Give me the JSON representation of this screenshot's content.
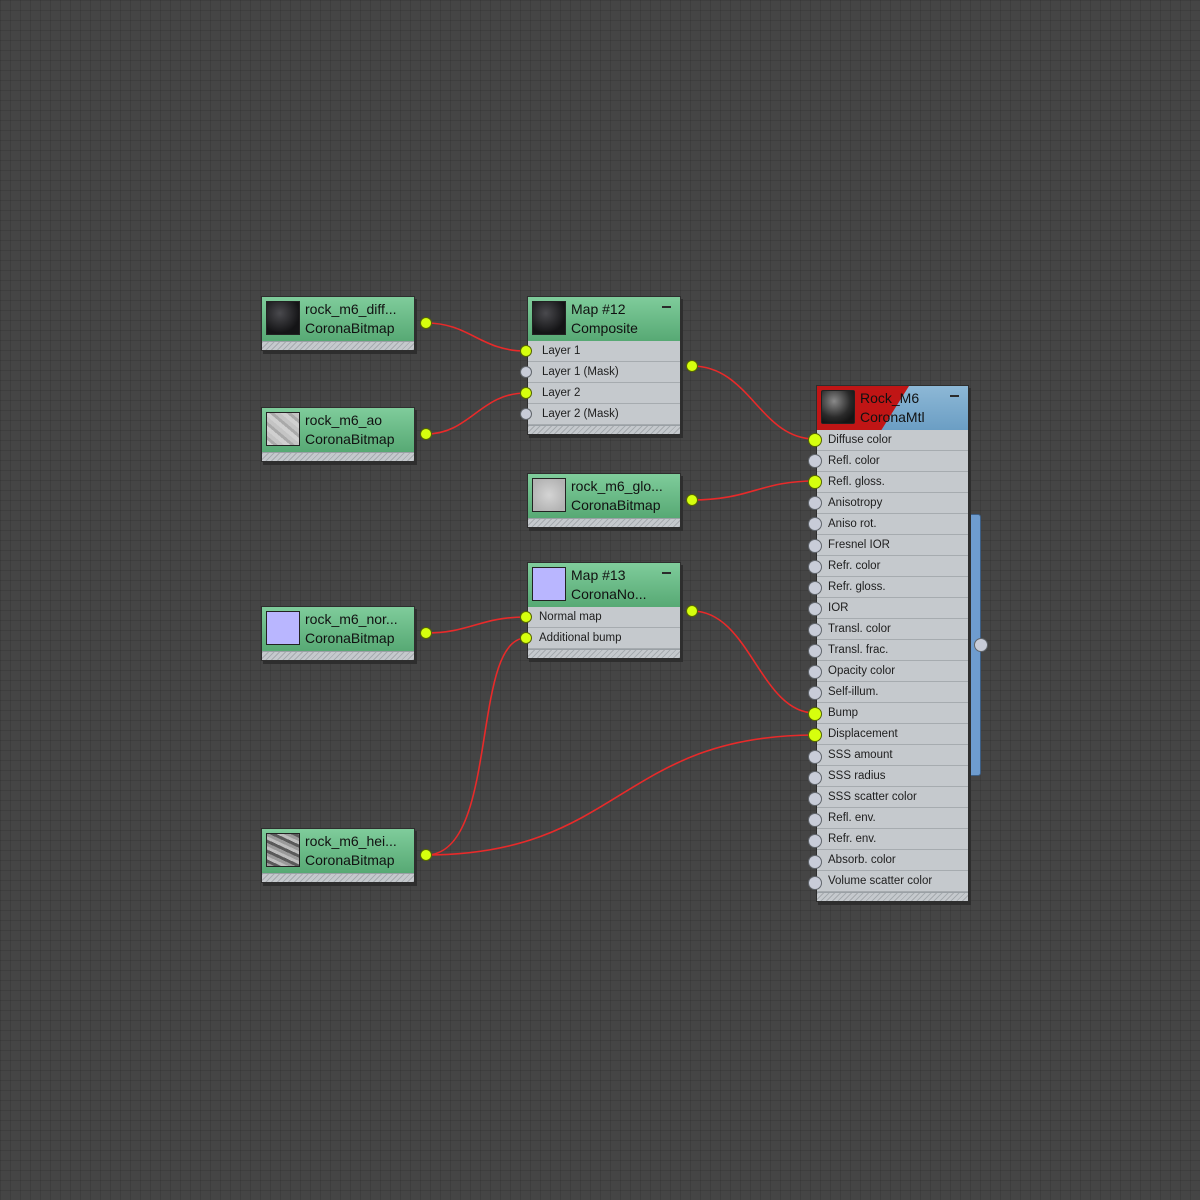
{
  "bitmap_nodes": [
    {
      "name": "rock_m6_diff...",
      "type": "CoronaBitmap",
      "texture": "dark-rock-texture"
    },
    {
      "name": "rock_m6_ao",
      "type": "CoronaBitmap",
      "texture": "ambient-occlusion-texture"
    },
    {
      "name": "rock_m6_glo...",
      "type": "CoronaBitmap",
      "texture": "glossiness-texture"
    },
    {
      "name": "rock_m6_nor...",
      "type": "CoronaBitmap",
      "texture": "normal-map-texture"
    },
    {
      "name": "rock_m6_hei...",
      "type": "CoronaBitmap",
      "texture": "height-map-texture"
    }
  ],
  "composite_node": {
    "name": "Map #12",
    "type": "Composite",
    "slots": [
      "Layer 1",
      "Layer 1 (Mask)",
      "Layer 2",
      "Layer 2 (Mask)"
    ],
    "connected": [
      true,
      false,
      true,
      false
    ]
  },
  "normal_node": {
    "name": "Map #13",
    "type": "CoronaNo...",
    "slots": [
      "Normal map",
      "Additional bump"
    ],
    "connected": [
      true,
      true
    ]
  },
  "material_node": {
    "name": "Rock_M6",
    "type": "CoronaMtl",
    "slots": [
      "Diffuse color",
      "Refl. color",
      "Refl. gloss.",
      "Anisotropy",
      "Aniso rot.",
      "Fresnel IOR",
      "Refr. color",
      "Refr. gloss.",
      "IOR",
      "Transl. color",
      "Transl. frac.",
      "Opacity color",
      "Self-illum.",
      "Bump",
      "Displacement",
      "SSS amount",
      "SSS radius",
      "SSS scatter color",
      "Refl. env.",
      "Refr. env.",
      "Absorb. color",
      "Volume scatter color"
    ],
    "connected": [
      true,
      false,
      true,
      false,
      false,
      false,
      false,
      false,
      false,
      false,
      false,
      false,
      false,
      true,
      true,
      false,
      false,
      false,
      false,
      false,
      false,
      false
    ]
  },
  "colors": {
    "wire": "#e82a2a",
    "port_connected": "#d6ff0e",
    "port_empty": "#c8ccd8",
    "map_header": "#6bbd88",
    "material_header": "#7aabcf",
    "material_accent": "#c01515"
  }
}
